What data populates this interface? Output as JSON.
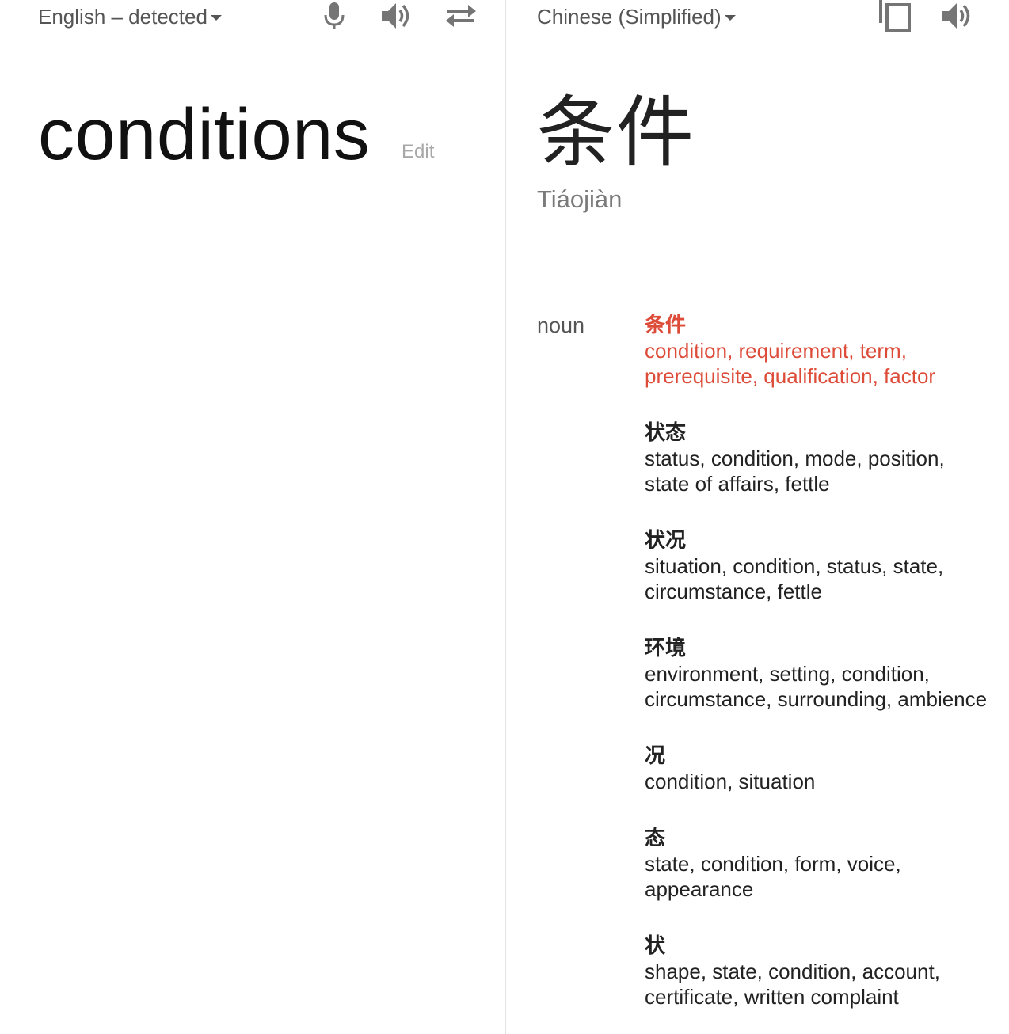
{
  "source": {
    "language_label": "English – detected",
    "text": "conditions",
    "edit_label": "Edit",
    "icons": [
      "microphone-icon",
      "speaker-icon",
      "swap-languages-icon"
    ]
  },
  "target": {
    "language_label": "Chinese (Simplified)",
    "text": "条件",
    "romanization": "Tiáojiàn",
    "icons": [
      "copy-icon",
      "speaker-icon"
    ]
  },
  "dictionary": {
    "part_of_speech": "noun",
    "entries": [
      {
        "term": "条件",
        "translations": "condition, requirement, term, prerequisite, qualification, factor",
        "highlighted": true
      },
      {
        "term": "状态",
        "translations": "status, condition, mode, position, state of affairs, fettle",
        "highlighted": false
      },
      {
        "term": "状况",
        "translations": "situation, condition, status, state, circumstance, fettle",
        "highlighted": false
      },
      {
        "term": "环境",
        "translations": "environment, setting, condition, circumstance, surrounding, ambience",
        "highlighted": false
      },
      {
        "term": "况",
        "translations": "condition, situation",
        "highlighted": false
      },
      {
        "term": "态",
        "translations": "state, condition, form, voice, appearance",
        "highlighted": false
      },
      {
        "term": "状",
        "translations": "shape, state, condition, account, certificate, written complaint",
        "highlighted": false
      }
    ]
  },
  "colors": {
    "highlight": "#dd4b39",
    "icon": "#757575",
    "muted": "#a8a8a8"
  }
}
